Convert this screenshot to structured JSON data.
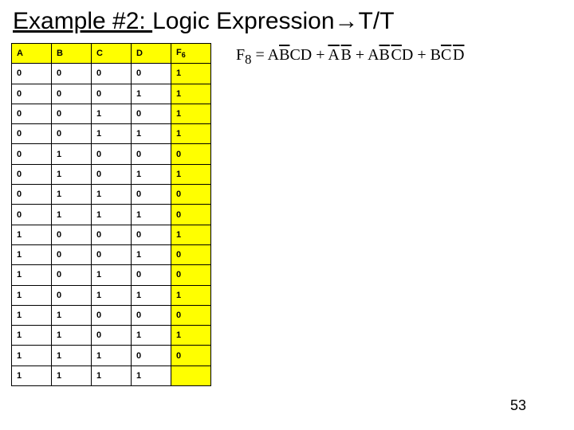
{
  "title_parts": {
    "underlined": "Example #2: ",
    "rest": "Logic Expression→T/T"
  },
  "table": {
    "headers": [
      "A",
      "B",
      "C",
      "D",
      "F"
    ],
    "header_sub": "6",
    "rows": [
      [
        "0",
        "0",
        "0",
        "0",
        "1"
      ],
      [
        "0",
        "0",
        "0",
        "1",
        "1"
      ],
      [
        "0",
        "0",
        "1",
        "0",
        "1"
      ],
      [
        "0",
        "0",
        "1",
        "1",
        "1"
      ],
      [
        "0",
        "1",
        "0",
        "0",
        "0"
      ],
      [
        "0",
        "1",
        "0",
        "1",
        "1"
      ],
      [
        "0",
        "1",
        "1",
        "0",
        "0"
      ],
      [
        "0",
        "1",
        "1",
        "1",
        "0"
      ],
      [
        "1",
        "0",
        "0",
        "0",
        "1"
      ],
      [
        "1",
        "0",
        "0",
        "1",
        "0"
      ],
      [
        "1",
        "0",
        "1",
        "0",
        "0"
      ],
      [
        "1",
        "0",
        "1",
        "1",
        "1"
      ],
      [
        "1",
        "1",
        "0",
        "0",
        "0"
      ],
      [
        "1",
        "1",
        "0",
        "1",
        "1"
      ],
      [
        "1",
        "1",
        "1",
        "0",
        "0"
      ],
      [
        "1",
        "1",
        "1",
        "1",
        ""
      ]
    ]
  },
  "expression": {
    "lhs_F": "F",
    "lhs_sub": "8",
    "eq": " = ",
    "t1": {
      "a": "A",
      "b": "B",
      "c": "C",
      "d": "D",
      "ov": [
        "B"
      ]
    },
    "plus": " + ",
    "t2": {
      "a": "A",
      "b": "B",
      "ov": [
        "A",
        "B"
      ]
    },
    "t3": {
      "a": "A",
      "b": "B",
      "c": "C",
      "d": "D",
      "ov": [
        "B",
        "C"
      ]
    },
    "t4": {
      "b": "B",
      "c": "C",
      "d": "D",
      "ov": [
        "C",
        "D"
      ]
    }
  },
  "page_number": "53"
}
